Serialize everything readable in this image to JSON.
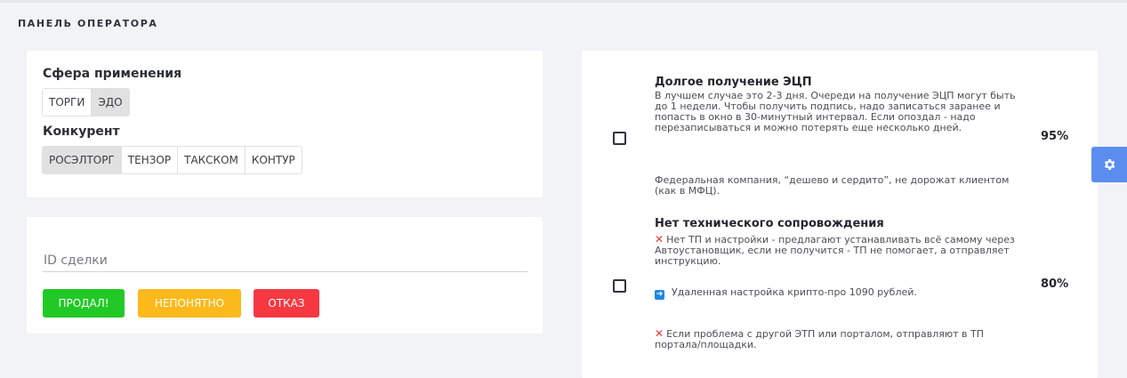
{
  "header": {
    "title": "ПАНЕЛЬ ОПЕРАТОРА"
  },
  "filters": {
    "scope_label": "Сфера применения",
    "scope_options": [
      {
        "label": "ТОРГИ",
        "active": false
      },
      {
        "label": "ЭДО",
        "active": true
      }
    ],
    "competitor_label": "Конкурент",
    "competitor_options": [
      {
        "label": "РОСЭЛТОРГ",
        "active": true
      },
      {
        "label": "ТЕНЗОР",
        "active": false
      },
      {
        "label": "ТАКСКОМ",
        "active": false
      },
      {
        "label": "КОНТУР",
        "active": false
      }
    ]
  },
  "deal": {
    "id_placeholder": "ID сделки",
    "id_value": "",
    "buttons": {
      "sold": "ПРОДАЛ!",
      "unclear": "НЕПОНЯТНО",
      "refuse": "ОТКАЗ"
    }
  },
  "objections": [
    {
      "title": "Долгое получение ЭЦП",
      "text1": "В лучшем случае это 2-3 дня. Очереди на получение ЭЦП могут быть до 1 недели. Чтобы получить подпись, надо записаться заранее и попасть в окно в 30-минутный интервал. Если опоздал - надо перезаписываться и можно потерять еще несколько дней.",
      "text2": "Федеральная компания, “дешево и сердито”, не дорожат клиентом (как в МФЦ).",
      "percent": "95%",
      "checked": false
    },
    {
      "title": "Нет технического сопровождения",
      "text1": "Нет ТП и настройки - предлагают устанавливать всё самому через Автоустановщик, если не получится - ТП не помогает, а отправляет инструкцию.",
      "text2": "Удаленная настройка крипто-про 1090 рублей.",
      "text3": "Если проблема с другой ЭТП или порталом, отправляют в ТП портала/площадки.",
      "percent": "80%",
      "checked": false
    }
  ],
  "icons": {
    "settings": "gear-icon",
    "cross": "cross-icon",
    "arrow": "arrow-right-icon"
  },
  "colors": {
    "sold": "#21c926",
    "unclear": "#fbb91b",
    "refuse": "#f63843",
    "settings": "#5b8def"
  }
}
